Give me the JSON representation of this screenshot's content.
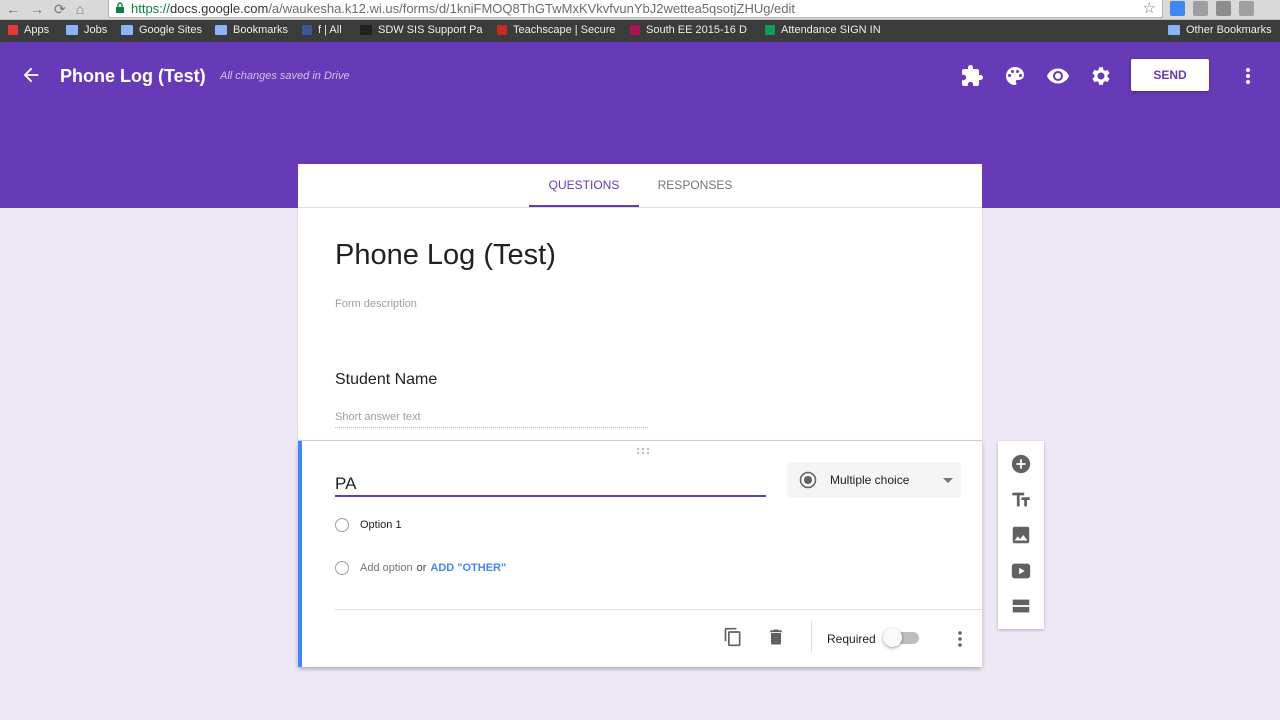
{
  "browser": {
    "url_protocol": "https://",
    "url_host": "docs.google.com",
    "url_path": "/a/waukesha.k12.wi.us/forms/d/1kniFMOQ8ThGTwMxKVkvfvunYbJ2wettea5qsotjZHUg/edit",
    "bookmarks": [
      "Apps",
      "Jobs",
      "Google Sites",
      "Bookmarks",
      "f | All",
      "SDW SIS Support Pa",
      "Teachscape | Secure",
      "South EE 2015-16 D",
      "Attendance SIGN IN"
    ],
    "other_bookmarks": "Other Bookmarks"
  },
  "header": {
    "title": "Phone Log (Test)",
    "status": "All changes saved in Drive",
    "send_label": "SEND",
    "color": "#673ab7"
  },
  "tabs": [
    {
      "label": "QUESTIONS",
      "active": true
    },
    {
      "label": "RESPONSES",
      "active": false
    }
  ],
  "form": {
    "title": "Phone Log (Test)",
    "description_placeholder": "Form description",
    "questions": [
      {
        "title": "Student Name",
        "answer_placeholder": "Short answer text"
      }
    ]
  },
  "active_question": {
    "title_value": "PA",
    "type": "Multiple choice",
    "options": [
      "Option 1"
    ],
    "add_option": "Add option",
    "or_label": "or",
    "add_other": "ADD \"OTHER\"",
    "required_label": "Required",
    "required": false
  },
  "icons": {
    "header": [
      "back-arrow-icon",
      "add-ons-icon",
      "palette-icon",
      "preview-eye-icon",
      "settings-gear-icon",
      "more-vert-icon"
    ],
    "sidebar": [
      "add-question-icon",
      "add-title-icon",
      "add-image-icon",
      "add-video-icon",
      "add-section-icon"
    ],
    "footer": [
      "duplicate-icon",
      "delete-icon",
      "more-vert-icon"
    ]
  }
}
